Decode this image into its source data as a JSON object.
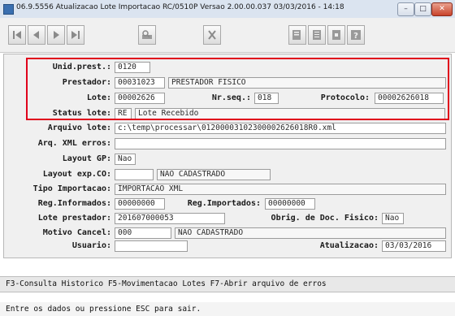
{
  "window": {
    "title": "06.9.5556 Atualizacao Lote Importacao RC/0510P Versao 2.00.00.037 03/03/2016 - 14:18",
    "min_label": "–",
    "max_label": "□",
    "close_label": "✕"
  },
  "toolbar": {
    "icons": [
      "first-record-icon",
      "previous-record-icon",
      "next-record-icon",
      "last-record-icon",
      "lookup-icon",
      "cancel-icon",
      "document-icon",
      "list-icon",
      "exit-icon",
      "help-icon"
    ]
  },
  "form": {
    "unid_prest": {
      "label": "Unid.prest.:",
      "value": "0120"
    },
    "prestador": {
      "label": "Prestador:",
      "code": "00031023",
      "name": "PRESTADOR FISICO"
    },
    "lote": {
      "label": "Lote:",
      "value": "00002626"
    },
    "nr_seq": {
      "label": "Nr.seq.:",
      "value": "018"
    },
    "protocolo": {
      "label": "Protocolo:",
      "value": "00002626018"
    },
    "status_lote": {
      "label": "Status lote:",
      "code": "RE",
      "desc": "Lote Recebido"
    },
    "arquivo_lote": {
      "label": "Arquivo lote:",
      "value": "c:\\temp\\processar\\01200003102300002626018R0.xml"
    },
    "arq_xml_erros": {
      "label": "Arq. XML erros:",
      "value": ""
    },
    "layout_gp": {
      "label": "Layout GP:",
      "value": "Nao"
    },
    "layout_exp_co": {
      "label": "Layout exp.CO:",
      "code": "",
      "desc": "NAO CADASTRADO"
    },
    "tipo_importacao": {
      "label": "Tipo Importacao:",
      "value": "IMPORTACAO XML"
    },
    "reg_informados": {
      "label": "Reg.Informados:",
      "value": "00000000"
    },
    "reg_importados": {
      "label": "Reg.Importados:",
      "value": "00000000"
    },
    "lote_prestador": {
      "label": "Lote prestador:",
      "value": "201607000053"
    },
    "obrig_doc_fisico": {
      "label": "Obrig. de Doc. Fisico:",
      "value": "Nao"
    },
    "motivo_cancel": {
      "label": "Motivo Cancel:",
      "code": "000",
      "desc": "NAO CADASTRADO"
    },
    "usuario": {
      "label": "Usuario:",
      "value": ""
    },
    "atualizacao": {
      "label": "Atualizacao:",
      "value": "03/03/2016"
    }
  },
  "function_keys": "F3-Consulta Historico F5-Movimentacao Lotes F7-Abrir arquivo de erros",
  "status_message": "Entre os dados ou pressione ESC para sair.",
  "colors": {
    "highlight": "#e0001b",
    "titlebar": "#dbe4f0"
  }
}
